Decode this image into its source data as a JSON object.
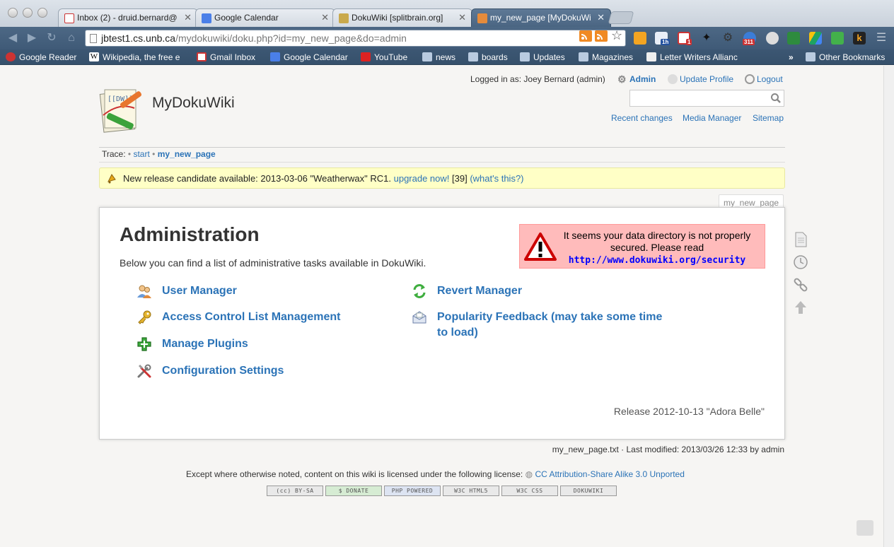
{
  "browser": {
    "tabs": [
      {
        "title": "Inbox (2) - druid.bernard@",
        "favicon": "gmail-icon",
        "active": false
      },
      {
        "title": "Google Calendar",
        "favicon": "calendar-icon",
        "active": false
      },
      {
        "title": "DokuWiki [splitbrain.org]",
        "favicon": "dokuwiki-icon",
        "active": false
      },
      {
        "title": "my_new_page [MyDokuWi",
        "favicon": "dokuwiki-icon",
        "active": true
      }
    ],
    "url_host": "jbtest1.cs.unb.ca",
    "url_path": "/mydokuwiki/doku.php?id=my_new_page&do=admin",
    "extension_badges": {
      "calendar": "1h",
      "gmail": "1",
      "feeds": "311"
    },
    "bookmarks": [
      {
        "label": "Google Reader",
        "icon": "google-reader-icon"
      },
      {
        "label": "Wikipedia, the free e",
        "icon": "wikipedia-icon"
      },
      {
        "label": "Gmail Inbox",
        "icon": "gmail-icon"
      },
      {
        "label": "Google Calendar",
        "icon": "calendar-icon"
      },
      {
        "label": "YouTube",
        "icon": "youtube-icon"
      },
      {
        "label": "news",
        "icon": "folder-icon"
      },
      {
        "label": "boards",
        "icon": "folder-icon"
      },
      {
        "label": "Updates",
        "icon": "folder-icon"
      },
      {
        "label": "Magazines",
        "icon": "folder-icon"
      },
      {
        "label": "Letter Writers Allianc",
        "icon": "page-icon"
      }
    ],
    "bookmarks_overflow": "»",
    "other_bookmarks": "Other Bookmarks"
  },
  "header": {
    "logged_in": "Logged in as: Joey Bernard (admin)",
    "admin": "Admin",
    "update_profile": "Update Profile",
    "logout": "Logout",
    "site_title": "MyDokuWiki",
    "recent_changes": "Recent changes",
    "media_manager": "Media Manager",
    "sitemap": "Sitemap"
  },
  "trace": {
    "label": "Trace:",
    "sep": "•",
    "start": "start",
    "current": "my_new_page"
  },
  "notice": {
    "text": "New release candidate available: 2013-03-06 \"Weatherwax\" RC1.",
    "upgrade": "upgrade now!",
    "num": "[39]",
    "whats_this": "(what's this?)"
  },
  "page_tab": "my_new_page",
  "admin": {
    "title": "Administration",
    "intro": "Below you can find a list of administrative tasks available in DokuWiki.",
    "security_text": "It seems your data directory is not properly secured. Please read",
    "security_link": "http://www.dokuwiki.org/security",
    "items_left": [
      {
        "label": "User Manager",
        "icon": "users-icon"
      },
      {
        "label": "Access Control List Management",
        "icon": "key-icon"
      },
      {
        "label": "Manage Plugins",
        "icon": "plugin-plus-icon"
      },
      {
        "label": "Configuration Settings",
        "icon": "tools-icon"
      }
    ],
    "items_right": [
      {
        "label": "Revert Manager",
        "icon": "revert-icon"
      },
      {
        "label": "Popularity Feedback (may take some time to load)",
        "icon": "envelope-icon"
      }
    ],
    "release": "Release 2012-10-13 \"Adora Belle\""
  },
  "footer": {
    "docinfo": "my_new_page.txt · Last modified: 2013/03/26 12:33 by admin",
    "license_text": "Except where otherwise noted, content on this wiki is licensed under the following license:",
    "license_link": "CC Attribution-Share Alike 3.0 Unported",
    "badges": [
      "(cc) BY-SA",
      "$ DONATE",
      "PHP POWERED",
      "W3C HTML5",
      "W3C CSS",
      "DOKUWIKI"
    ]
  },
  "colors": {
    "link": "#2b73b7",
    "notice_bg": "#ffffc6",
    "warning_bg": "#ffbbbb"
  }
}
